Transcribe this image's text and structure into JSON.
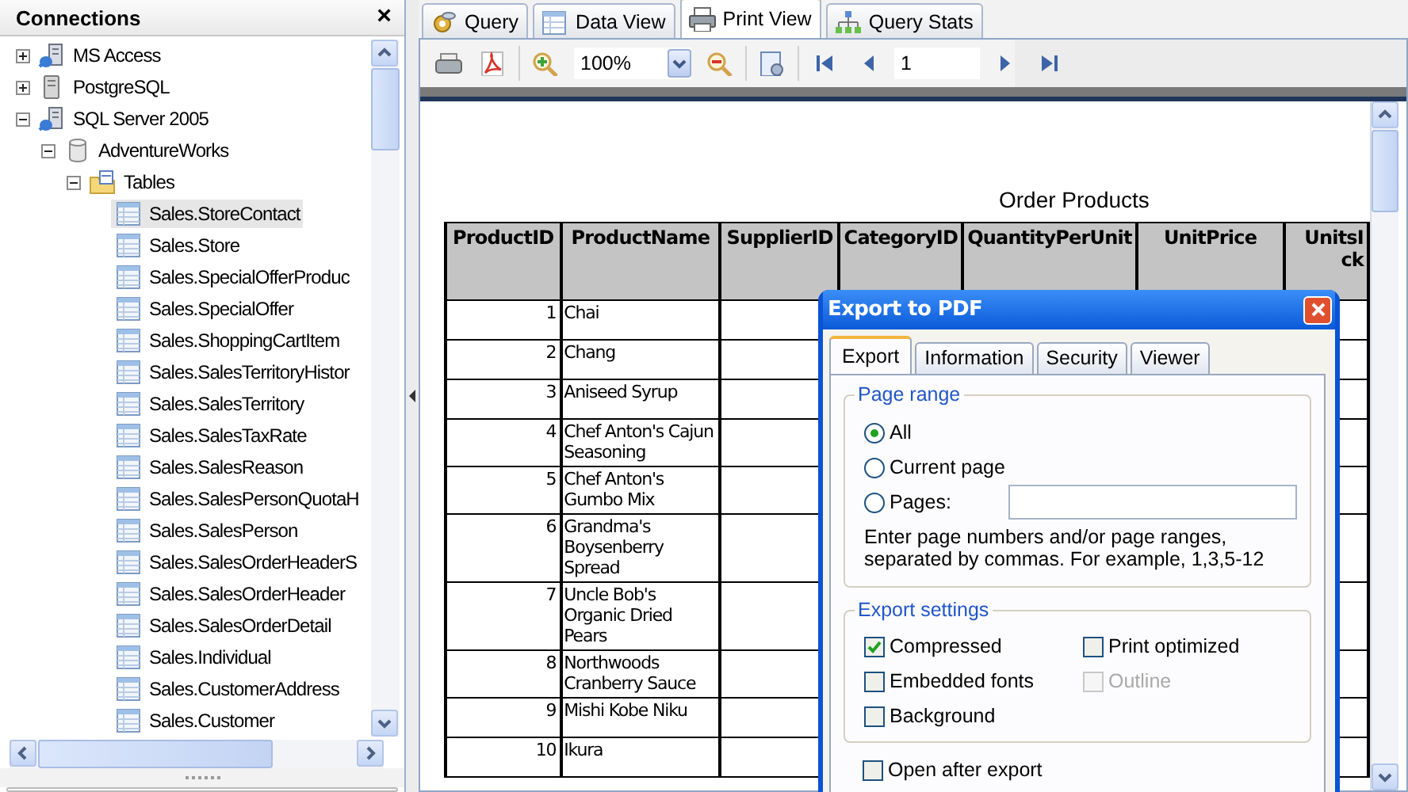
{
  "left_panel": {
    "title": "Connections",
    "close": "×",
    "tree": [
      {
        "label": "MS Access",
        "kind": "connection",
        "expanded": false,
        "selected": false
      },
      {
        "label": "PostgreSQL",
        "kind": "server",
        "expanded": false,
        "selected": false
      },
      {
        "label": "SQL Server 2005",
        "kind": "connection",
        "expanded": true,
        "selected": false,
        "children": [
          {
            "label": "AdventureWorks",
            "kind": "database",
            "expanded": true,
            "selected": false,
            "children": [
              {
                "label": "Tables",
                "kind": "folder",
                "expanded": true,
                "selected": false,
                "children": [
                  {
                    "label": "Sales.StoreContact",
                    "kind": "table",
                    "selected": true
                  },
                  {
                    "label": "Sales.Store",
                    "kind": "table",
                    "selected": false
                  },
                  {
                    "label": "Sales.SpecialOfferProduc",
                    "kind": "table",
                    "selected": false
                  },
                  {
                    "label": "Sales.SpecialOffer",
                    "kind": "table",
                    "selected": false
                  },
                  {
                    "label": "Sales.ShoppingCartItem",
                    "kind": "table",
                    "selected": false
                  },
                  {
                    "label": "Sales.SalesTerritoryHistor",
                    "kind": "table",
                    "selected": false
                  },
                  {
                    "label": "Sales.SalesTerritory",
                    "kind": "table",
                    "selected": false
                  },
                  {
                    "label": "Sales.SalesTaxRate",
                    "kind": "table",
                    "selected": false
                  },
                  {
                    "label": "Sales.SalesReason",
                    "kind": "table",
                    "selected": false
                  },
                  {
                    "label": "Sales.SalesPersonQuotaH",
                    "kind": "table",
                    "selected": false
                  },
                  {
                    "label": "Sales.SalesPerson",
                    "kind": "table",
                    "selected": false
                  },
                  {
                    "label": "Sales.SalesOrderHeaderS",
                    "kind": "table",
                    "selected": false
                  },
                  {
                    "label": "Sales.SalesOrderHeader",
                    "kind": "table",
                    "selected": false
                  },
                  {
                    "label": "Sales.SalesOrderDetail",
                    "kind": "table",
                    "selected": false
                  },
                  {
                    "label": "Sales.Individual",
                    "kind": "table",
                    "selected": false
                  },
                  {
                    "label": "Sales.CustomerAddress",
                    "kind": "table",
                    "selected": false
                  },
                  {
                    "label": "Sales.Customer",
                    "kind": "table",
                    "selected": false
                  }
                ]
              }
            ]
          }
        ]
      }
    ]
  },
  "tabs": [
    {
      "label": "Query",
      "selected": false
    },
    {
      "label": "Data View",
      "selected": false
    },
    {
      "label": "Print View",
      "selected": true
    },
    {
      "label": "Query Stats",
      "selected": false
    }
  ],
  "toolbar": {
    "zoom": "100%",
    "page": "1"
  },
  "report": {
    "title": "Order Products",
    "columns": [
      "ProductID",
      "ProductName",
      "SupplierID",
      "CategoryID",
      "QuantityPerUnit",
      "UnitPrice",
      "UnitsI\nck"
    ],
    "rows": [
      {
        "product_id": "1",
        "product_name": "Chai"
      },
      {
        "product_id": "2",
        "product_name": "Chang"
      },
      {
        "product_id": "3",
        "product_name": "Aniseed Syrup"
      },
      {
        "product_id": "4",
        "product_name": "Chef Anton's Cajun Seasoning"
      },
      {
        "product_id": "5",
        "product_name": "Chef Anton's Gumbo Mix"
      },
      {
        "product_id": "6",
        "product_name": "Grandma's Boysenberry Spread"
      },
      {
        "product_id": "7",
        "product_name": "Uncle Bob's Organic Dried Pears"
      },
      {
        "product_id": "8",
        "product_name": "Northwoods Cranberry Sauce"
      },
      {
        "product_id": "9",
        "product_name": "Mishi Kobe Niku"
      },
      {
        "product_id": "10",
        "product_name": "Ikura"
      }
    ]
  },
  "dialog": {
    "title": "Export to PDF",
    "tabs": [
      {
        "label": "Export",
        "selected": true
      },
      {
        "label": "Information",
        "selected": false
      },
      {
        "label": "Security",
        "selected": false
      },
      {
        "label": "Viewer",
        "selected": false
      }
    ],
    "page_range": {
      "legend": "Page range",
      "options": [
        {
          "label": "All",
          "kind": "plain",
          "selected": true
        },
        {
          "label": "Current page",
          "kind": "plain",
          "selected": false
        },
        {
          "label": "Pages:",
          "kind": "with_field",
          "selected": false
        }
      ],
      "hint": "Enter page numbers and/or page ranges,\nseparated by commas. For example, 1,3,5-12"
    },
    "export_settings": {
      "legend": "Export settings",
      "options": [
        {
          "label": "Compressed",
          "checked": true,
          "disabled": false
        },
        {
          "label": "Print optimized",
          "checked": false,
          "disabled": false
        },
        {
          "label": "Embedded fonts",
          "checked": false,
          "disabled": false
        },
        {
          "label": "Outline",
          "checked": false,
          "disabled": true
        },
        {
          "label": "Background",
          "checked": false,
          "disabled": false
        }
      ]
    },
    "open_after_export": {
      "label": "Open after export",
      "checked": false
    }
  }
}
